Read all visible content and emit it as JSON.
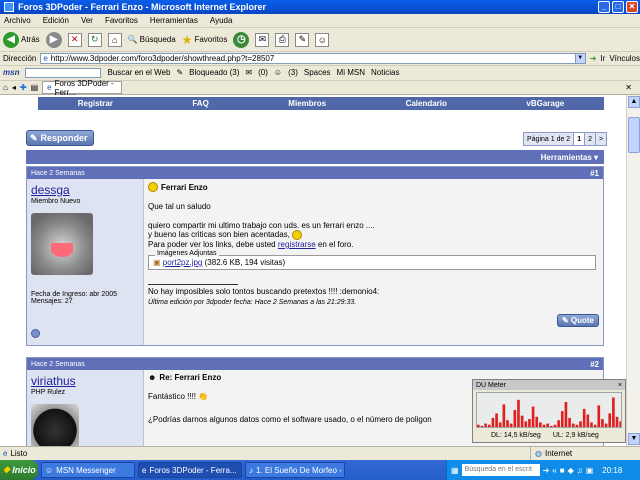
{
  "window": {
    "title": "Foros 3DPoder - Ferrari Enzo - Microsoft Internet Explorer"
  },
  "menubar": [
    "Archivo",
    "Edición",
    "Ver",
    "Favoritos",
    "Herramientas",
    "Ayuda"
  ],
  "toolbar": {
    "back": "Atrás",
    "search": "Búsqueda",
    "favorites": "Favoritos"
  },
  "address": {
    "label": "Dirección",
    "url": "http://www.3dpoder.com/foro3dpoder/showthread.php?t=28507",
    "go": "Ir",
    "links": "Vínculos"
  },
  "msn": {
    "logo": "msn",
    "search_web": "Buscar en el Web",
    "blocked": "Bloqueado (3)",
    "count1": "(0)",
    "count2": "(3)",
    "spaces": "Spaces",
    "mymsn": "Mi MSN",
    "news": "Noticias"
  },
  "tab": {
    "label": "Foros 3DPoder - Ferr..."
  },
  "forum": {
    "nav": [
      "Registrar",
      "FAQ",
      "Miembros",
      "Calendario",
      "vBGarage"
    ],
    "reply_button": "Responder",
    "pager": {
      "label": "Página 1 de 2",
      "pages": [
        "1",
        "2"
      ],
      "next": ">"
    },
    "tools": "Herramientas ▾",
    "posts": [
      {
        "date": "Hace 2 Semanas",
        "number": "#1",
        "username": "dessga",
        "rank": "Miembro Nuevo",
        "joined": "Fecha de Ingreso: abr 2005",
        "messages": "Mensajes: 27",
        "title": "Ferrari Enzo",
        "lines": [
          "Que tal un saludo",
          "quiero compartir mi ultimo trabajo con uds. es un ferrari enzo ....",
          "y bueno las criticas son bien acentadas,"
        ],
        "links_prefix": "Para poder ver los links, debe usted",
        "links_action": "registrarse",
        "links_suffix": "en el foro.",
        "attach_legend": "Imágenes Adjuntas",
        "attach_file": "port2pz.jpg",
        "attach_info": "(382.6 KB, 194 visitas)",
        "signature": "No hay imposibles solo tontos buscando pretextos !!!! :demonio4:",
        "edited": "Última edición por 3dpoder fecha: Hace 2 Semanas a las 21:29:33.",
        "quote": "Quote"
      },
      {
        "date": "Hace 2 Semanas",
        "number": "#2",
        "username": "viriathus",
        "rank": "PHP Rulez",
        "title": "Re: Ferrari Enzo",
        "line1": "Fantástico !!!!",
        "line2": "¿Podrías darnos algunos datos como el software usado, o el número de poligon"
      }
    ]
  },
  "dumeter": {
    "title": "DU Meter",
    "dl": "DL: 14,5 kB/seg",
    "ul": "UL: 2,9 kB/seg",
    "bars": [
      2,
      1,
      3,
      2,
      8,
      12,
      4,
      20,
      6,
      3,
      15,
      24,
      10,
      5,
      7,
      18,
      9,
      4,
      2,
      3,
      1,
      2,
      6,
      14,
      22,
      8,
      3,
      2,
      5,
      16,
      11,
      4,
      2,
      19,
      7,
      3,
      12,
      26,
      9,
      5
    ]
  },
  "statusbar": {
    "text": "Listo",
    "zone": "Internet"
  },
  "taskbar": {
    "start": "Inicio",
    "tasks": [
      "MSN Messenger",
      "Foros 3DPoder - Ferra...",
      "1. El Sueño De Morfeo - ..."
    ],
    "search_placeholder": "Búsqueda en el escrit",
    "clock": "20:18"
  }
}
